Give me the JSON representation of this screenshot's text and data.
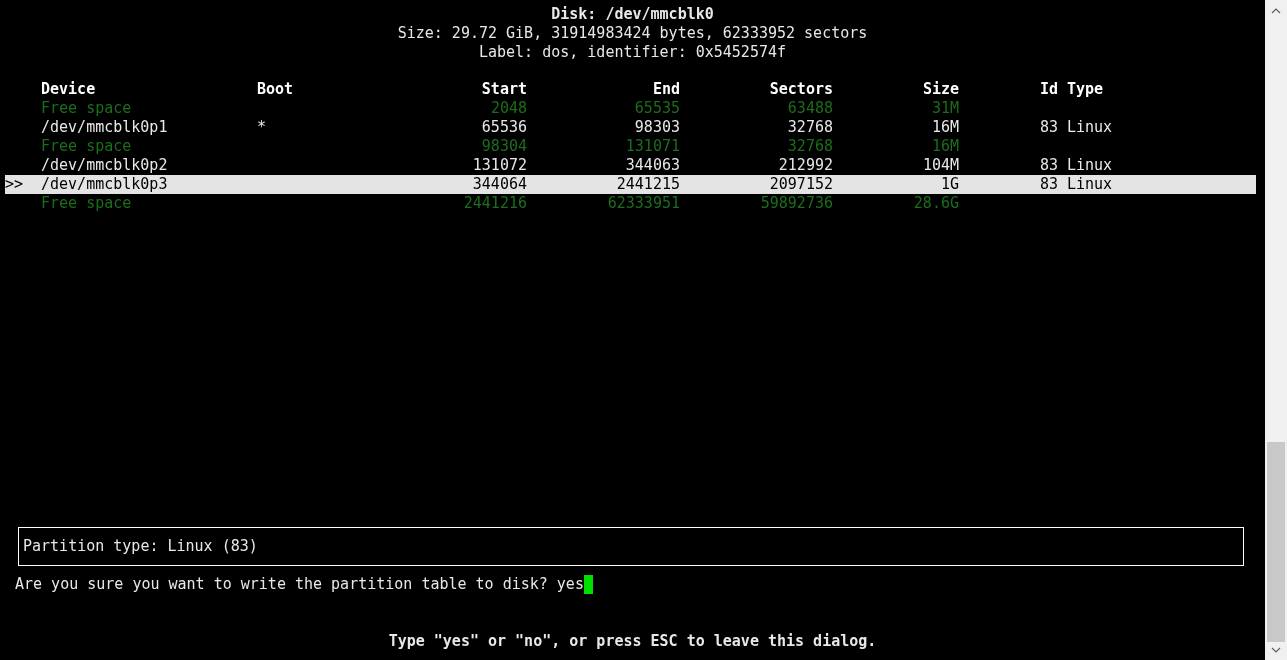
{
  "disk": {
    "title": "Disk: /dev/mmcblk0",
    "size_line": "Size: 29.72 GiB, 31914983424 bytes, 62333952 sectors",
    "label_line": "Label: dos, identifier: 0x5452574f"
  },
  "table": {
    "cursor": ">>",
    "columns": [
      "Device",
      "Boot",
      "Start",
      "End",
      "Sectors",
      "Size",
      "Id",
      "Type"
    ],
    "rows": [
      {
        "kind": "free",
        "selected": false,
        "device": "Free space",
        "start": "2048",
        "end": "65535",
        "sectors": "63488",
        "size": "31M"
      },
      {
        "kind": "partition",
        "selected": false,
        "device": "/dev/mmcblk0p1",
        "boot": "*",
        "start": "65536",
        "end": "98303",
        "sectors": "32768",
        "size": "16M",
        "id": "83",
        "type": "Linux"
      },
      {
        "kind": "free",
        "selected": false,
        "device": "Free space",
        "start": "98304",
        "end": "131071",
        "sectors": "32768",
        "size": "16M"
      },
      {
        "kind": "partition",
        "selected": false,
        "device": "/dev/mmcblk0p2",
        "start": "131072",
        "end": "344063",
        "sectors": "212992",
        "size": "104M",
        "id": "83",
        "type": "Linux"
      },
      {
        "kind": "partition",
        "selected": true,
        "device": "/dev/mmcblk0p3",
        "start": "344064",
        "end": "2441215",
        "sectors": "2097152",
        "size": "1G",
        "id": "83",
        "type": "Linux"
      },
      {
        "kind": "free",
        "selected": false,
        "device": "Free space",
        "start": "2441216",
        "end": "62333951",
        "sectors": "59892736",
        "size": "28.6G"
      }
    ]
  },
  "info_box": "Partition type: Linux (83)",
  "prompt": {
    "question": "Are you sure you want to write the partition table to disk?",
    "value": "yes"
  },
  "hint": "Type \"yes\" or \"no\", or press ESC to leave this dialog."
}
